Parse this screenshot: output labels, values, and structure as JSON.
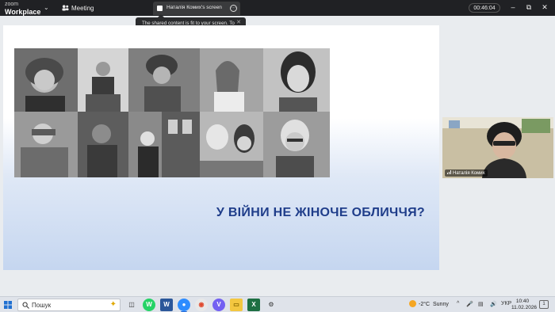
{
  "titlebar": {
    "brand_small": "zoom",
    "brand_large": "Workplace",
    "meeting_label": "Meeting",
    "share_tab_label": "Наталія Комих's screen",
    "timer": "00:46:04",
    "options_icon": "ellipsis-icon"
  },
  "tooltip": {
    "text": "The shared content is fit to your screen. To see the original size, click \"Original size\" in the menu."
  },
  "slide": {
    "title": "У ВІЙНИ НЕ ЖІНОЧЕ ОБЛИЧЧЯ?"
  },
  "participant": {
    "name": "Наталія Комих"
  },
  "taskbar": {
    "search_label": "Пошук",
    "weather_temp": "-2°C",
    "weather_text": "Sunny",
    "language": "УКР",
    "time": "10:40",
    "date": "11.02.2026",
    "notifications": "1"
  },
  "colors": {
    "titlebar_bg": "#202124",
    "slide_title": "#1f3d8a",
    "taskbar_bg": "#dfe3ea"
  }
}
